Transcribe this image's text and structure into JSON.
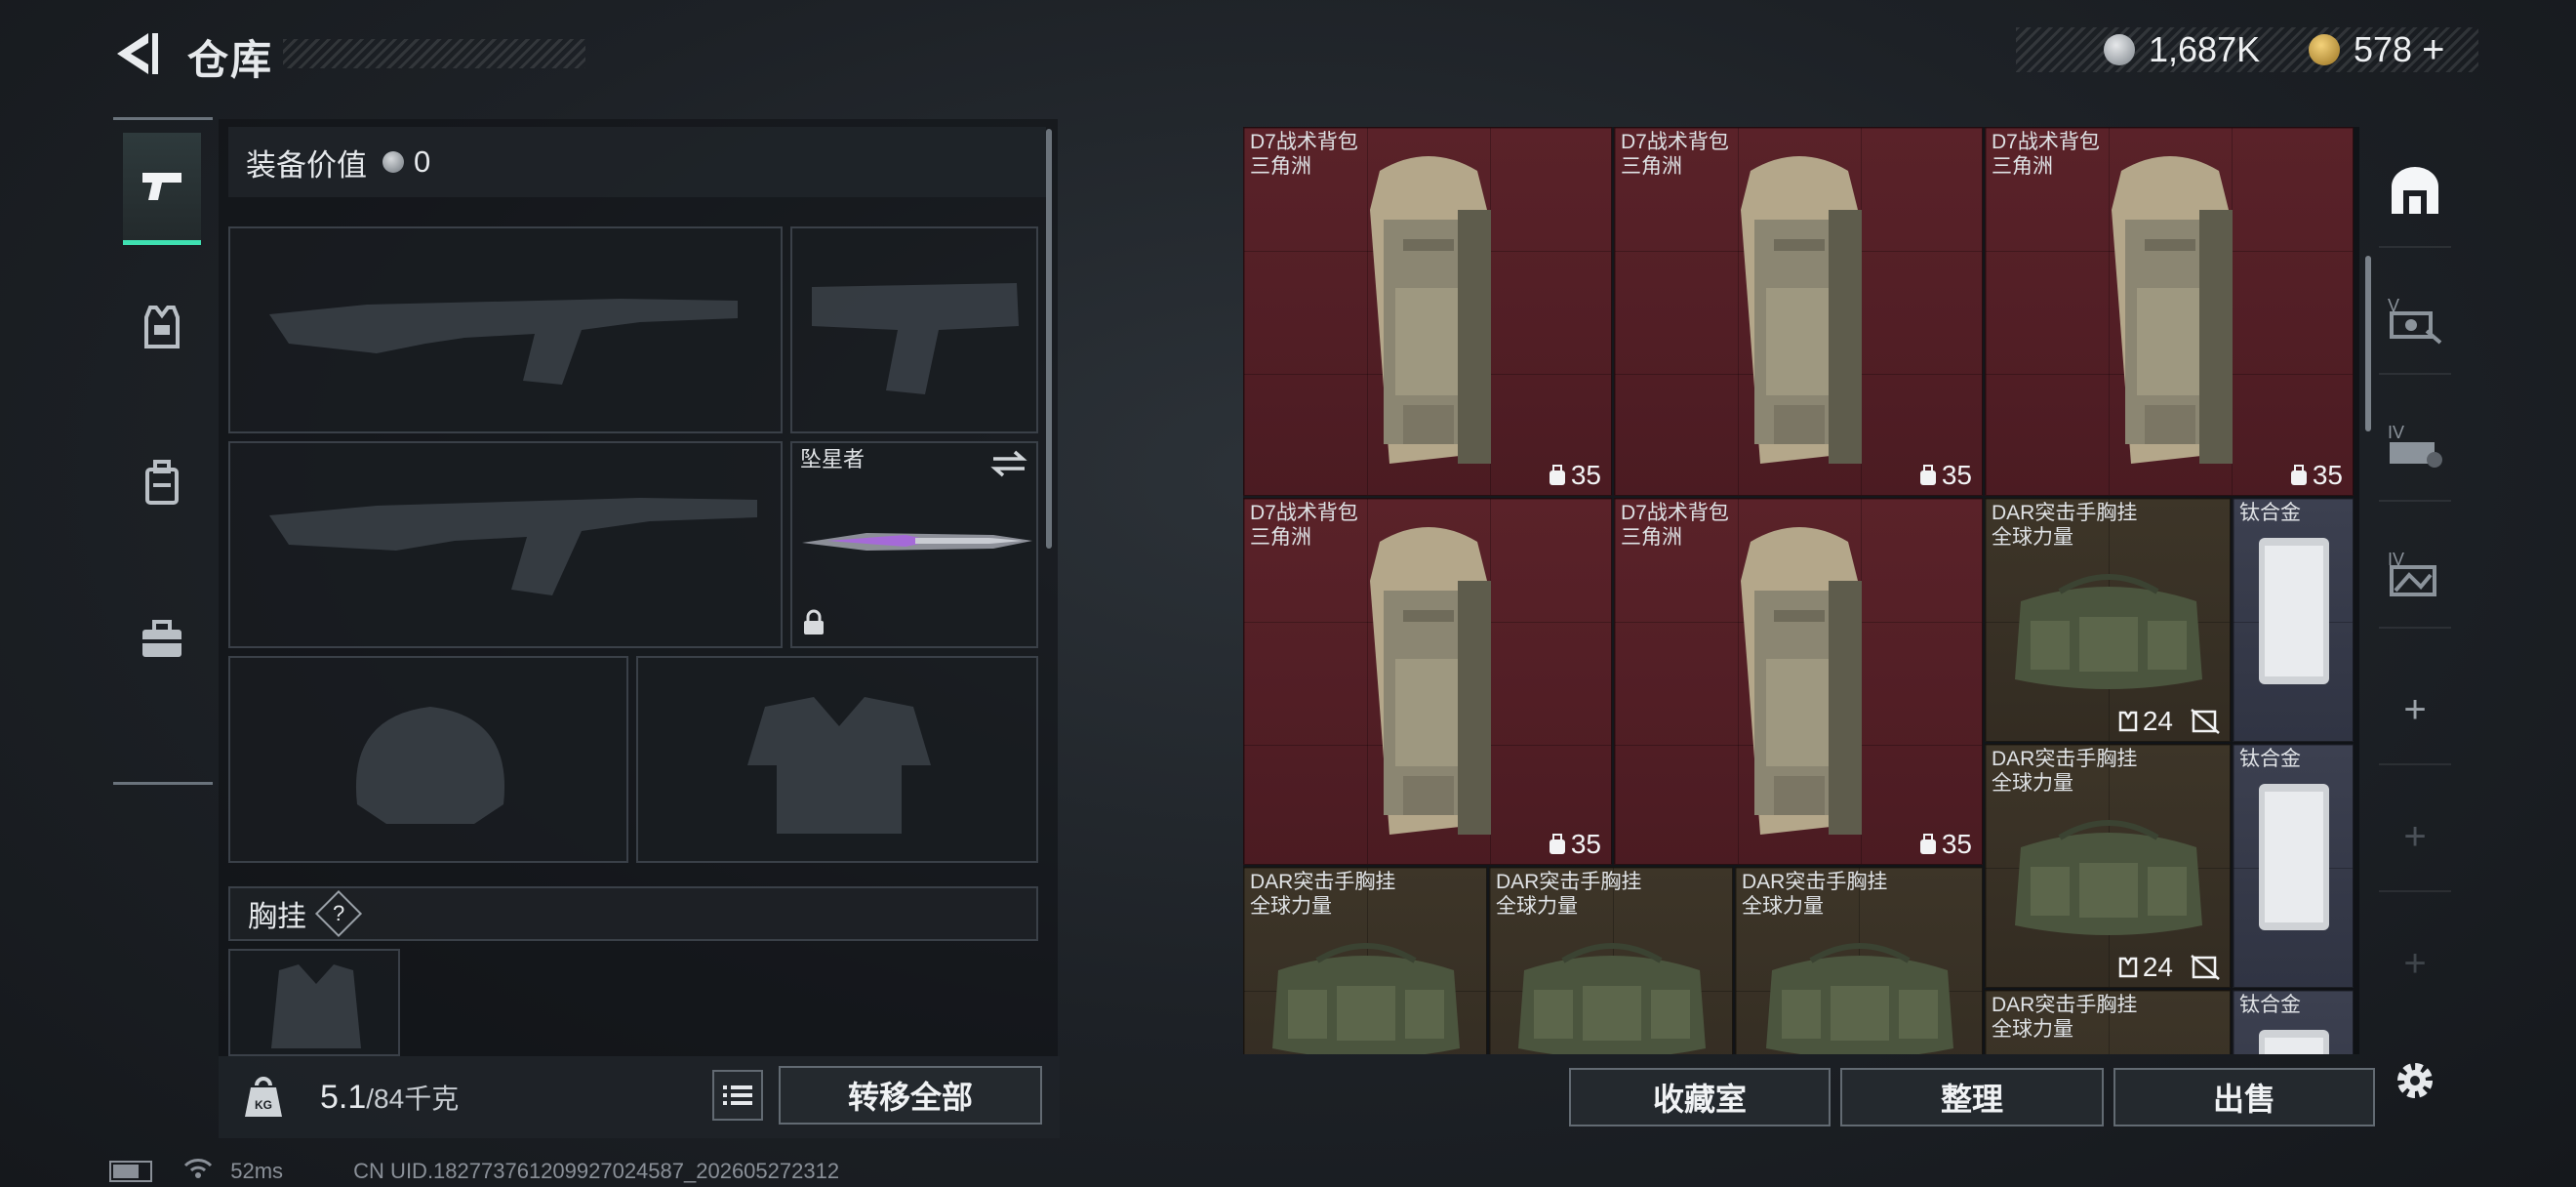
{
  "header": {
    "title": "仓库"
  },
  "currency": [
    {
      "icon": "silver-coin-icon",
      "value": "1,687K"
    },
    {
      "icon": "gold-coin-icon",
      "value": "578"
    }
  ],
  "add_label": "+",
  "left_tabs": [
    "pistol-icon",
    "armor-vest-icon",
    "backpack-icon",
    "toolbox-icon"
  ],
  "equip_value": {
    "label": "装备价值",
    "value": "0"
  },
  "melee": {
    "name": "坠星者"
  },
  "chest_rig": {
    "label": "胸挂",
    "help": "?"
  },
  "weight": {
    "current": "5.1",
    "max_unit": "/84千克",
    "kg_label": "KG"
  },
  "buttons": {
    "transfer_all": "转移全部",
    "collection": "收藏室",
    "sort": "整理",
    "sell": "出售"
  },
  "storage_items": [
    {
      "name": "D7战术背包",
      "brand": "三角洲",
      "badge": "35"
    },
    {
      "name": "D7战术背包",
      "brand": "三角洲",
      "badge": "35"
    },
    {
      "name": "D7战术背包",
      "brand": "三角洲",
      "badge": "35"
    },
    {
      "name": "D7战术背包",
      "brand": "三角洲",
      "badge": "35"
    },
    {
      "name": "D7战术背包",
      "brand": "三角洲",
      "badge": "35"
    },
    {
      "name": "DAR突击手胸挂",
      "brand": "全球力量",
      "badge": "24"
    },
    {
      "name": "钛合金",
      "brand": "",
      "badge": ""
    },
    {
      "name": "DAR突击手胸挂",
      "brand": "全球力量",
      "badge": "24"
    },
    {
      "name": "钛合金",
      "brand": "",
      "badge": ""
    },
    {
      "name": "DAR突击手胸挂",
      "brand": "全球力量",
      "badge": ""
    },
    {
      "name": "DAR突击手胸挂",
      "brand": "全球力量",
      "badge": ""
    },
    {
      "name": "DAR突击手胸挂",
      "brand": "全球力量",
      "badge": ""
    },
    {
      "name": "DAR突击手胸挂",
      "brand": "全球力量",
      "badge": ""
    },
    {
      "name": "钛合金",
      "brand": "",
      "badge": ""
    }
  ],
  "categories": [
    {
      "icon": "storage-home-icon",
      "active": true
    },
    {
      "icon": "storage-v-icon",
      "label": "V"
    },
    {
      "icon": "storage-iv-icon",
      "label": "IV"
    },
    {
      "icon": "storage-iv-extra-icon",
      "label": "IV"
    },
    {
      "icon": "add-storage-icon"
    },
    {
      "icon": "add-storage-icon"
    },
    {
      "icon": "add-storage-icon"
    }
  ],
  "status": {
    "ping": "52ms",
    "uid": "CN UID.182773761209927024587_202605272312"
  },
  "colors": {
    "accent": "#3fe0b1",
    "item_red": "#4e1d23",
    "item_brown": "#372f25",
    "item_slate": "#353949"
  }
}
